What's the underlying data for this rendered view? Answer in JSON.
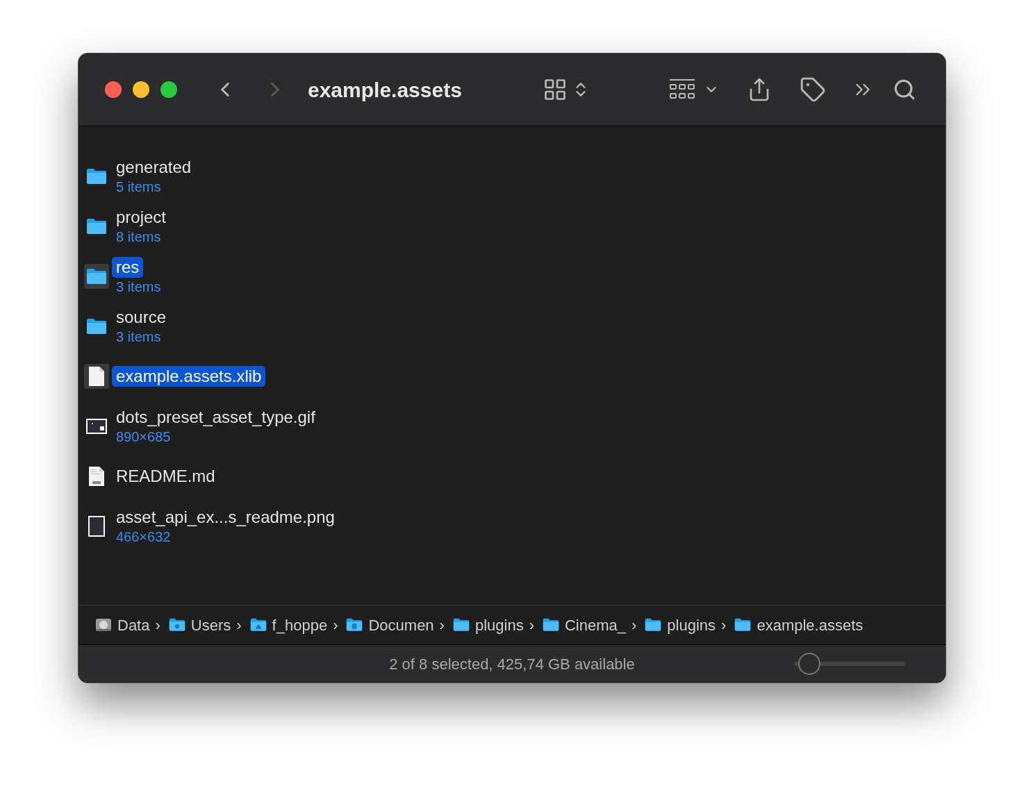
{
  "window": {
    "title": "example.assets"
  },
  "toolbar": {
    "back_enabled": true,
    "forward_enabled": false
  },
  "items": [
    {
      "name": "generated",
      "detail": "5 items",
      "kind": "folder",
      "selected": false
    },
    {
      "name": "project",
      "detail": "8 items",
      "kind": "folder",
      "selected": false
    },
    {
      "name": "res",
      "detail": "3 items",
      "kind": "folder",
      "selected": true
    },
    {
      "name": "source",
      "detail": "3 items",
      "kind": "folder",
      "selected": false
    },
    {
      "name": "example.assets.xlib",
      "kind": "file",
      "selected": true
    },
    {
      "name": "dots_preset_asset_type.gif",
      "detail": "890×685",
      "kind": "image",
      "selected": false
    },
    {
      "name": "README.md",
      "kind": "markdown",
      "selected": false
    },
    {
      "name": "asset_api_ex...s_readme.png",
      "detail": "466×632",
      "kind": "tall-image",
      "selected": false
    }
  ],
  "path_bar": {
    "separator": "›",
    "items": [
      {
        "name": "Data",
        "kind": "drive"
      },
      {
        "name": "Users",
        "kind": "user-folder"
      },
      {
        "name": "f_hoppe",
        "kind": "home-folder"
      },
      {
        "name": "Documen",
        "kind": "document-folder"
      },
      {
        "name": "plugins",
        "kind": "folder"
      },
      {
        "name": "Cinema_",
        "kind": "folder"
      },
      {
        "name": "plugins",
        "kind": "folder"
      },
      {
        "name": "example.assets",
        "kind": "folder"
      }
    ]
  },
  "status_bar": {
    "text": "2 of 8 selected, 425,74 GB available",
    "icon_size": {
      "level": 0.05
    }
  }
}
